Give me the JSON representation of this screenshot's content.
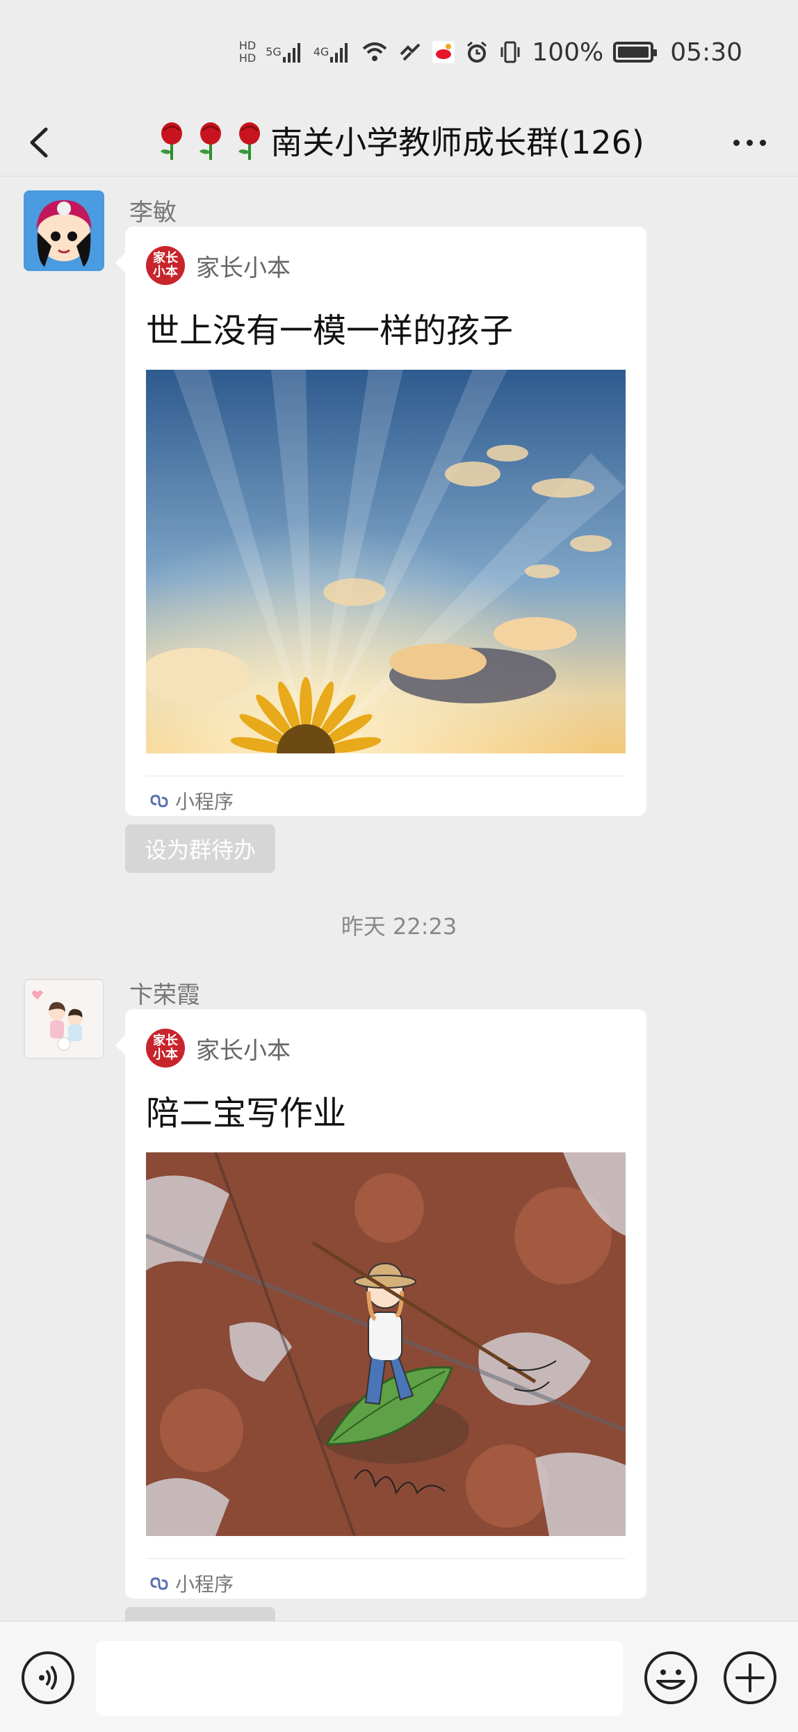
{
  "status_bar": {
    "network_5g": "5G",
    "network_4g": "4G",
    "hd": "HD",
    "battery_percent": "100%",
    "time": "05:30"
  },
  "header": {
    "title": "南关小学教师成长群(126)"
  },
  "messages": [
    {
      "sender": "李敏",
      "source_logo_text": "家长小本",
      "source_name": "家长小本",
      "title": "世上没有一模一样的孩子",
      "footer_label": "小程序",
      "todo_label": "设为群待办"
    },
    {
      "sender": "卞荣霞",
      "source_logo_text": "家长小本",
      "source_name": "家长小本",
      "title": "陪二宝写作业",
      "footer_label": "小程序"
    }
  ],
  "timestamp": "昨天 22:23",
  "colors": {
    "background": "#ededed",
    "card": "#ffffff",
    "source_logo": "#c8242c",
    "mini_program_icon": "#5a6fb0"
  }
}
